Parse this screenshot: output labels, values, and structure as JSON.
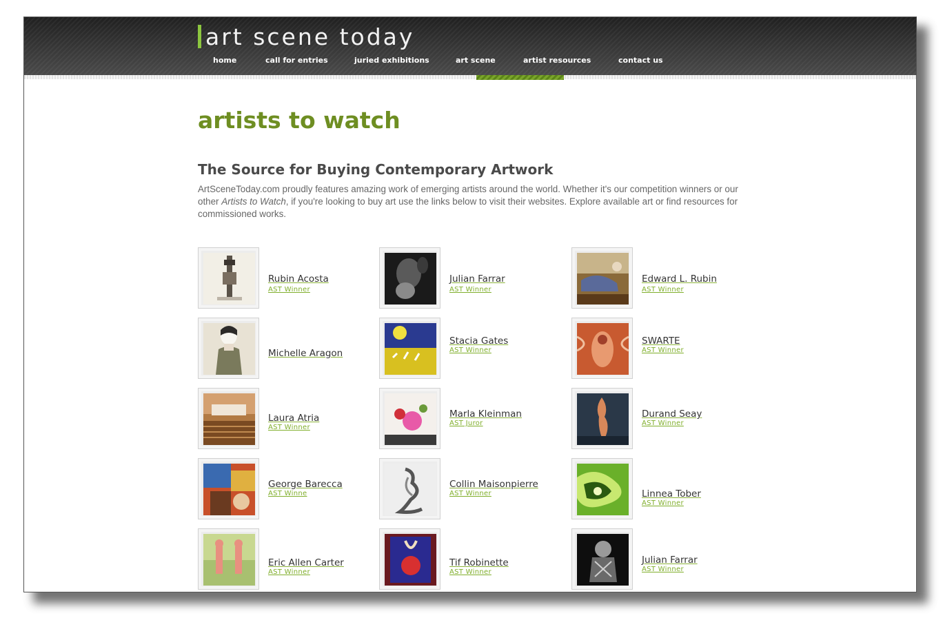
{
  "site": {
    "logo_text": "art scene today"
  },
  "nav": [
    "home",
    "call for entries",
    "juried exhibitions",
    "art scene",
    "artist resources",
    "contact us"
  ],
  "active_nav": "art scene",
  "page_title": "artists to watch",
  "section_title": "The Source for Buying Contemporary Artwork",
  "intro": {
    "part1": "ArtSceneToday.com proudly features amazing work of emerging artists around the world. Whether it's our competition winners or our other ",
    "emphasis": "Artists to Watch",
    "part2": ", if you're looking to buy art use the links below to visit their websites.  Explore available art or find resources for commissioned works."
  },
  "artists": [
    [
      {
        "name": "Rubin Acosta",
        "badge": "AST Winner"
      },
      {
        "name": "Michelle Aragon",
        "badge": ""
      },
      {
        "name": "Laura Atria",
        "badge": "AST Winner"
      },
      {
        "name": "George Barecca",
        "badge": "AST Winne"
      },
      {
        "name": "Eric Allen Carter",
        "badge": "AST Winner"
      }
    ],
    [
      {
        "name": "Julian Farrar",
        "badge": "AST Winner"
      },
      {
        "name": "Stacia Gates",
        "badge": "AST Winner"
      },
      {
        "name": "Marla Kleinman",
        "badge": "AST Juror"
      },
      {
        "name": "Collin Maisonpierre",
        "badge": "AST Winner"
      },
      {
        "name": "Tif Robinette",
        "badge": "AST Winner"
      }
    ],
    [
      {
        "name": "Edward L. Rubin",
        "badge": "AST Winner"
      },
      {
        "name": "SWARTE",
        "badge": "AST Winner"
      },
      {
        "name": "Durand Seay",
        "badge": "AST Winner"
      },
      {
        "name": "Linnea Tober",
        "badge": "AST Winner"
      },
      {
        "name": "Julian Farrar",
        "badge": "AST Winner"
      }
    ]
  ],
  "colors": {
    "accent": "#6e8e22",
    "logo_bar": "#8cc63f",
    "badge": "#7fae2a"
  }
}
